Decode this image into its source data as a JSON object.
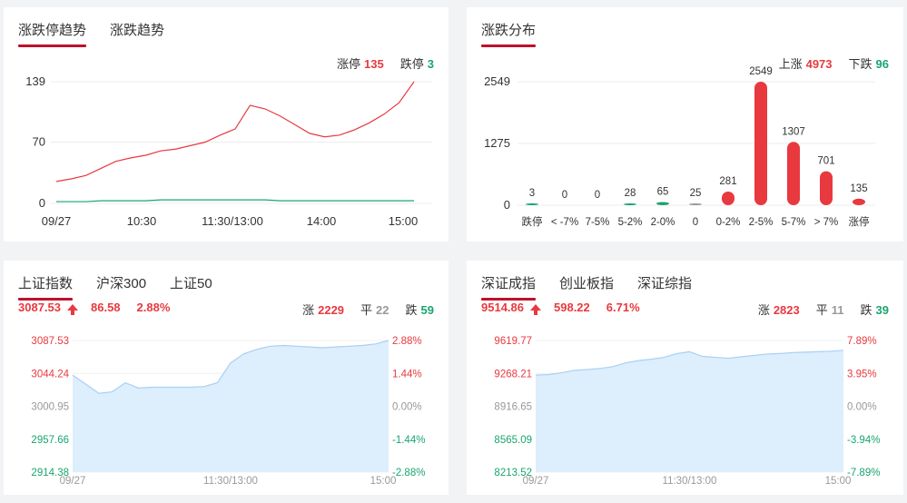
{
  "colors": {
    "up": "#e8393f",
    "down": "#1aa56f",
    "flat": "#999999",
    "accent": "#c0102a",
    "area": "#ddeefc",
    "area_line": "#a8d0f5"
  },
  "trend_panel": {
    "tabs": [
      "涨跌停趋势",
      "涨跌趋势"
    ],
    "limit_up_label": "涨停",
    "limit_up_value": "135",
    "limit_down_label": "跌停",
    "limit_down_value": "3",
    "y_ticks": [
      "139",
      "70",
      "0"
    ],
    "x_ticks": [
      "09/27",
      "10:30",
      "11:30/13:00",
      "14:00",
      "15:00"
    ]
  },
  "dist_panel": {
    "tabs": [
      "涨跌分布"
    ],
    "up_label": "上涨",
    "up_value": "4973",
    "down_label": "下跌",
    "down_value": "96",
    "y_ticks": [
      "2549",
      "1275",
      "0"
    ]
  },
  "sh_panel": {
    "tabs": [
      "上证指数",
      "沪深300",
      "上证50"
    ],
    "price": "3087.53",
    "change": "86.58",
    "pct": "2.88%",
    "up_label": "涨",
    "up_value": "2229",
    "flat_label": "平",
    "flat_value": "22",
    "down_label": "跌",
    "down_value": "59",
    "y_left": [
      "3087.53",
      "3044.24",
      "3000.95",
      "2957.66",
      "2914.38"
    ],
    "y_right": [
      "2.88%",
      "1.44%",
      "0.00%",
      "-1.44%",
      "-2.88%"
    ],
    "x_ticks": [
      "09/27",
      "11:30/13:00",
      "15:00"
    ]
  },
  "sz_panel": {
    "tabs": [
      "深证成指",
      "创业板指",
      "深证综指"
    ],
    "price": "9514.86",
    "change": "598.22",
    "pct": "6.71%",
    "up_label": "涨",
    "up_value": "2823",
    "flat_label": "平",
    "flat_value": "11",
    "down_label": "跌",
    "down_value": "39",
    "y_left": [
      "9619.77",
      "9268.21",
      "8916.65",
      "8565.09",
      "8213.52"
    ],
    "y_right": [
      "7.89%",
      "3.95%",
      "0.00%",
      "-3.94%",
      "-7.89%"
    ],
    "x_ticks": [
      "09/27",
      "11:30/13:00",
      "15:00"
    ]
  },
  "chart_data": [
    {
      "type": "line",
      "series": [
        {
          "name": "涨停",
          "values": [
            25,
            28,
            32,
            40,
            48,
            52,
            55,
            60,
            62,
            66,
            70,
            78,
            85,
            112,
            108,
            100,
            90,
            80,
            76,
            78,
            84,
            92,
            102,
            115,
            139
          ]
        },
        {
          "name": "跌停",
          "values": [
            2,
            2,
            2,
            3,
            3,
            3,
            3,
            4,
            4,
            4,
            4,
            4,
            4,
            4,
            4,
            3,
            3,
            3,
            3,
            3,
            3,
            3,
            3,
            3,
            3
          ]
        }
      ],
      "y_ticks": [
        0,
        70,
        139
      ],
      "x_ticks": [
        "09/27",
        "10:30",
        "11:30/13:00",
        "14:00",
        "15:00"
      ],
      "ylim": [
        0,
        139
      ]
    },
    {
      "type": "bar",
      "categories": [
        "跌停",
        "< -7%",
        "7-5%",
        "5-2%",
        "2-0%",
        "0",
        "0-2%",
        "2-5%",
        "5-7%",
        "> 7%",
        "涨停"
      ],
      "values": [
        3,
        0,
        0,
        28,
        65,
        25,
        281,
        2549,
        1307,
        701,
        135
      ],
      "bar_colors": [
        "#1aa56f",
        "#1aa56f",
        "#1aa56f",
        "#1aa56f",
        "#1aa56f",
        "#999999",
        "#e8393f",
        "#e8393f",
        "#e8393f",
        "#e8393f",
        "#e8393f"
      ],
      "ylim": [
        0,
        2549
      ],
      "y_ticks": [
        0,
        1275,
        2549
      ]
    },
    {
      "type": "area",
      "series": [
        {
          "name": "上证指数",
          "values": [
            3042,
            3030,
            3018,
            3020,
            3032,
            3025,
            3026,
            3026,
            3026,
            3026,
            3027,
            3032,
            3058,
            3070,
            3076,
            3080,
            3081,
            3080,
            3079,
            3078,
            3079,
            3080,
            3081,
            3083,
            3087.53
          ]
        }
      ],
      "ylim": [
        2914.38,
        3087.53
      ],
      "x_ticks": [
        "09/27",
        "11:30/13:00",
        "15:00"
      ]
    },
    {
      "type": "area",
      "series": [
        {
          "name": "深证成指",
          "values": [
            9250,
            9255,
            9275,
            9300,
            9310,
            9320,
            9340,
            9380,
            9405,
            9420,
            9440,
            9480,
            9500,
            9450,
            9440,
            9430,
            9445,
            9460,
            9475,
            9480,
            9490,
            9495,
            9500,
            9505,
            9514.86
          ]
        }
      ],
      "ylim": [
        8213.52,
        9619.77
      ],
      "x_ticks": [
        "09/27",
        "11:30/13:00",
        "15:00"
      ]
    }
  ]
}
